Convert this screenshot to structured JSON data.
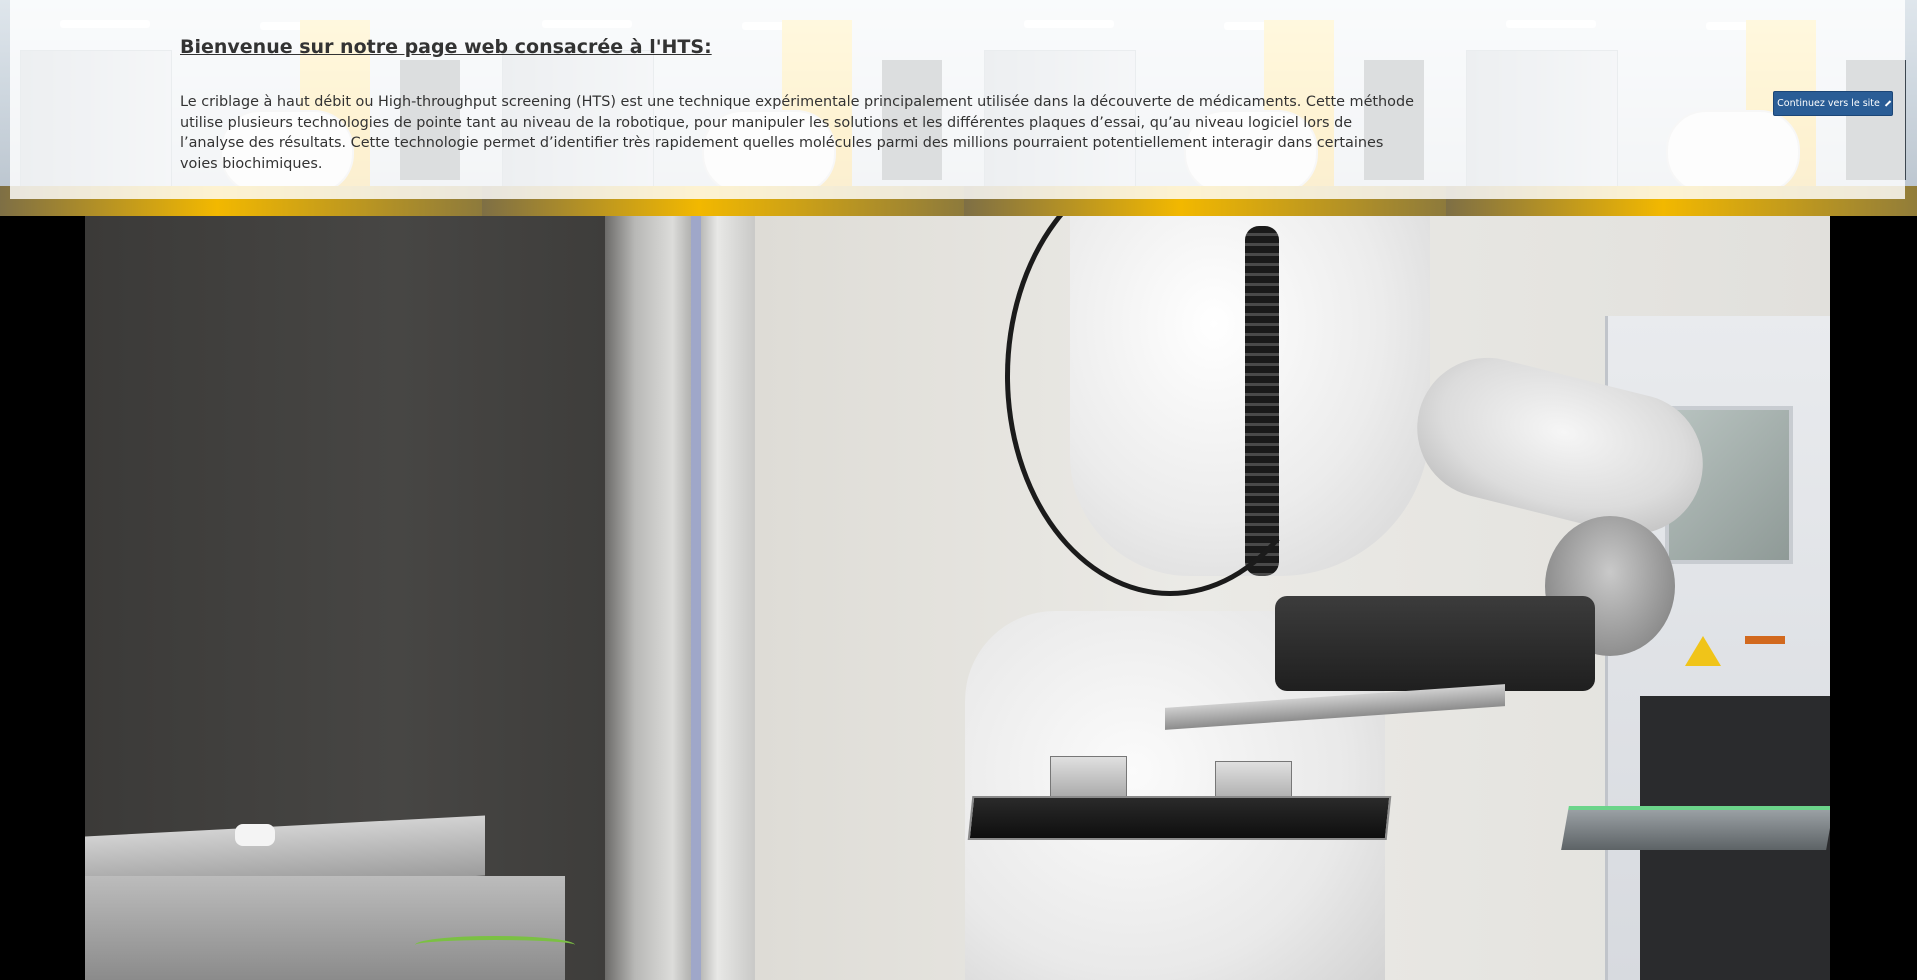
{
  "banner": {
    "title": "Bienvenue sur notre page web consacrée à l'HTS:",
    "paragraph": "Le criblage à haut débit ou High-throughput screening (HTS) est une technique expérimentale principalement utilisée dans la découverte de médicaments. Cette méthode utilise plusieurs technologies de pointe tant au niveau de la robotique, pour manipuler les solutions et les différentes plaques d’essai, qu’au niveau logiciel lors de l’analyse des résultats. Cette technologie permet d’identifier très rapidement quelles molécules parmi des millions pourraient potentiellement interagir dans certaines voies biochimiques.",
    "continue_button": {
      "label": "Continuez vers le site",
      "icon": "chevron-right-icon",
      "color": "#2a5d96"
    }
  },
  "colors": {
    "page_background": "#000000",
    "title_text": "#333333",
    "accent_yellow": "#f4b400"
  }
}
